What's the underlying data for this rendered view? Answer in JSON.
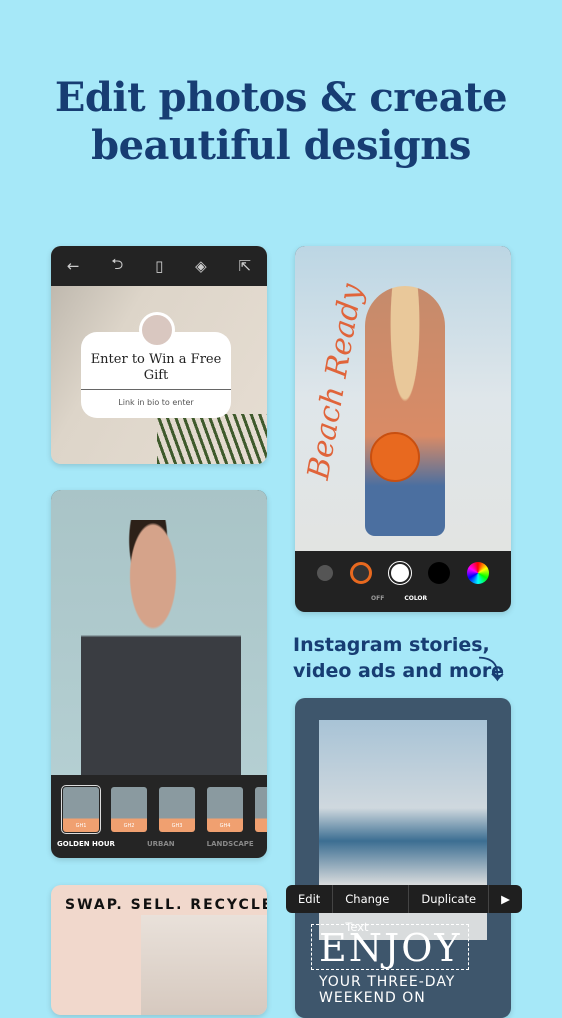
{
  "headline": {
    "line1": "Edit photos & create",
    "line2": "beautiful designs"
  },
  "card1": {
    "toolbar": [
      "←",
      "⮌",
      "▯",
      "◈",
      "⇱"
    ],
    "gift_title": "Enter to Win a Free Gift",
    "gift_sub": "Link in bio to enter"
  },
  "card2": {
    "script_text": "Beach Ready",
    "options": [
      "OFF",
      "COLOR"
    ],
    "accent": "#e8691f"
  },
  "card3": {
    "filters": [
      "GH1",
      "GH2",
      "GH3",
      "GH4"
    ],
    "categories": [
      "GOLDEN HOUR",
      "URBAN",
      "LANDSCAPE"
    ]
  },
  "card4": {
    "text": "SWAP. SELL. RECYCLE"
  },
  "caption": {
    "line1": "Instagram stories,",
    "line2": "video ads and more"
  },
  "card5": {
    "menu": [
      "Edit",
      "Change Text",
      "Duplicate",
      "▶"
    ],
    "title": "ENJOY",
    "sub1": "YOUR THREE-DAY",
    "sub2": "WEEKEND ON"
  }
}
